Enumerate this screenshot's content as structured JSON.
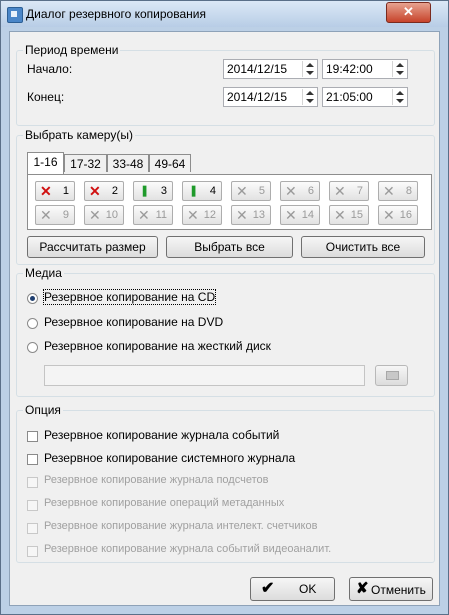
{
  "window": {
    "title": "Диалог резервного копирования",
    "close_glyph": "✕"
  },
  "period": {
    "title": "Период времени",
    "start_label": "Начало:",
    "start_date": "2014/12/15",
    "start_time": "19:42:00",
    "end_label": "Конец:",
    "end_date": "2014/12/15",
    "end_time": "21:05:00"
  },
  "cameras": {
    "title": "Выбрать камеру(ы)",
    "tabs": [
      "1-16",
      "17-32",
      "33-48",
      "49-64"
    ],
    "active_tab": "1-16",
    "buttons": [
      {
        "num": "1",
        "state": "red"
      },
      {
        "num": "2",
        "state": "red"
      },
      {
        "num": "3",
        "state": "green"
      },
      {
        "num": "4",
        "state": "green"
      },
      {
        "num": "5",
        "state": "off"
      },
      {
        "num": "6",
        "state": "off"
      },
      {
        "num": "7",
        "state": "off"
      },
      {
        "num": "8",
        "state": "off"
      },
      {
        "num": "9",
        "state": "off"
      },
      {
        "num": "10",
        "state": "off"
      },
      {
        "num": "11",
        "state": "off"
      },
      {
        "num": "12",
        "state": "off"
      },
      {
        "num": "13",
        "state": "off"
      },
      {
        "num": "14",
        "state": "off"
      },
      {
        "num": "15",
        "state": "off"
      },
      {
        "num": "16",
        "state": "off"
      }
    ],
    "calc_size_label": "Рассчитать размер",
    "select_all_label": "Выбрать все",
    "clear_all_label": "Очистить все"
  },
  "media": {
    "title": "Медиа",
    "options": [
      "Резервное копирование на CD",
      "Резервное копирование на DVD",
      "Резервное копирование на жесткий диск"
    ],
    "selected_index": 0,
    "path_value": ""
  },
  "options": {
    "title": "Опция",
    "items": [
      {
        "label": "Резервное копирование журнала событий",
        "enabled": true,
        "checked": false
      },
      {
        "label": "Резервное копирование системного журнала",
        "enabled": true,
        "checked": false
      },
      {
        "label": "Резервное копирование журнала подсчетов",
        "enabled": false,
        "checked": false
      },
      {
        "label": "Резервное копирование операций метаданных",
        "enabled": false,
        "checked": false
      },
      {
        "label": "Резервное копирование журнала интелект. счетчиков",
        "enabled": false,
        "checked": false
      },
      {
        "label": "Резервное копирование журнала событий видеоаналит.",
        "enabled": false,
        "checked": false
      }
    ]
  },
  "footer": {
    "ok_label": "OK",
    "cancel_label": "Отменить"
  },
  "colors": {
    "red_cross": "#d01010",
    "green_cam": "#1e9a2a",
    "disabled_text": "#a0a0a0"
  }
}
